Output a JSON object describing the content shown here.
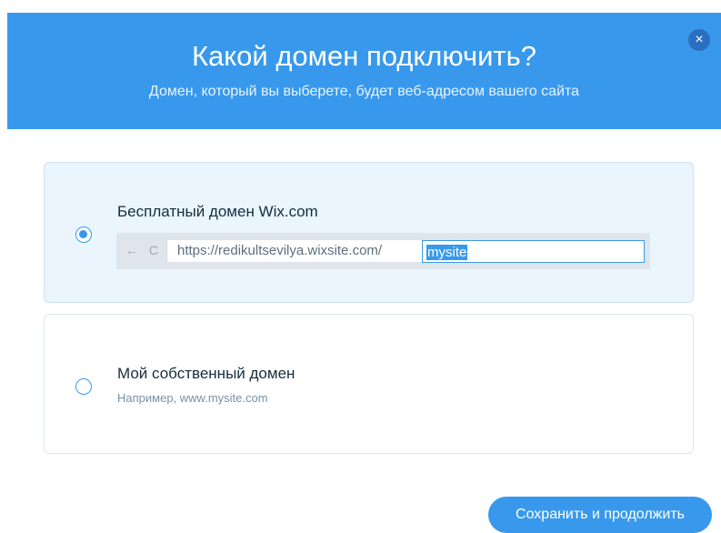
{
  "dialog": {
    "title": "Какой домен подключить?",
    "subtitle": "Домен, который вы выберете, будет веб-адресом вашего сайта",
    "close_icon": "×"
  },
  "options": {
    "free": {
      "label": "Бесплатный домен Wix.com",
      "selected": true,
      "url_prefix": "https://redikultsevilya.wixsite.com/",
      "site_name_value": "mysite",
      "nav_icons": "← C"
    },
    "own": {
      "label": "Мой собственный домен",
      "example": "Например, www.mysite.com",
      "selected": false
    }
  },
  "actions": {
    "save_label": "Сохранить и продолжить"
  },
  "colors": {
    "accent": "#3899ec",
    "header": "#3899ec",
    "selected_card": "#eaf5fe"
  }
}
